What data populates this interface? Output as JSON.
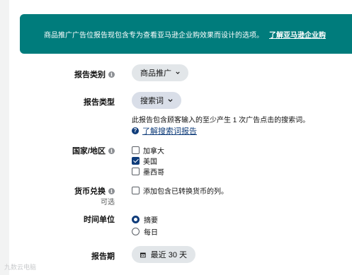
{
  "banner": {
    "text": "商品推广广告位报告现包含专为查看亚马逊企业购效果而设计的选项。",
    "link": "了解亚马逊企业购"
  },
  "report_category": {
    "label": "报告类别",
    "value": "商品推广"
  },
  "report_type": {
    "label": "报告类型",
    "value": "搜索词",
    "description": "此报告包含顾客输入的至少产生 1 次广告点击的搜索词。",
    "help_link": "了解搜索词报告"
  },
  "country_region": {
    "label": "国家/地区",
    "options": [
      {
        "label": "加拿大",
        "checked": false
      },
      {
        "label": "美国",
        "checked": true
      },
      {
        "label": "墨西哥",
        "checked": false
      }
    ]
  },
  "currency": {
    "label": "货币兑换",
    "sublabel": "可选",
    "option": "添加包含已转换货币的列。",
    "checked": false
  },
  "time_unit": {
    "label": "时间单位",
    "options": [
      {
        "label": "摘要",
        "selected": true
      },
      {
        "label": "每日",
        "selected": false
      }
    ]
  },
  "report_period": {
    "label": "报告期",
    "value": "最近 30 天"
  },
  "watermark": "九数云电脑",
  "colors": {
    "banner_bg": "#007c7c",
    "accent": "#0f3c7a",
    "pill_bg": "#e2e6e9"
  },
  "icons": {
    "info": "info-icon",
    "dropdown": "chevron-down-icon",
    "help": "question-circle-icon",
    "calendar": "calendar-icon"
  }
}
